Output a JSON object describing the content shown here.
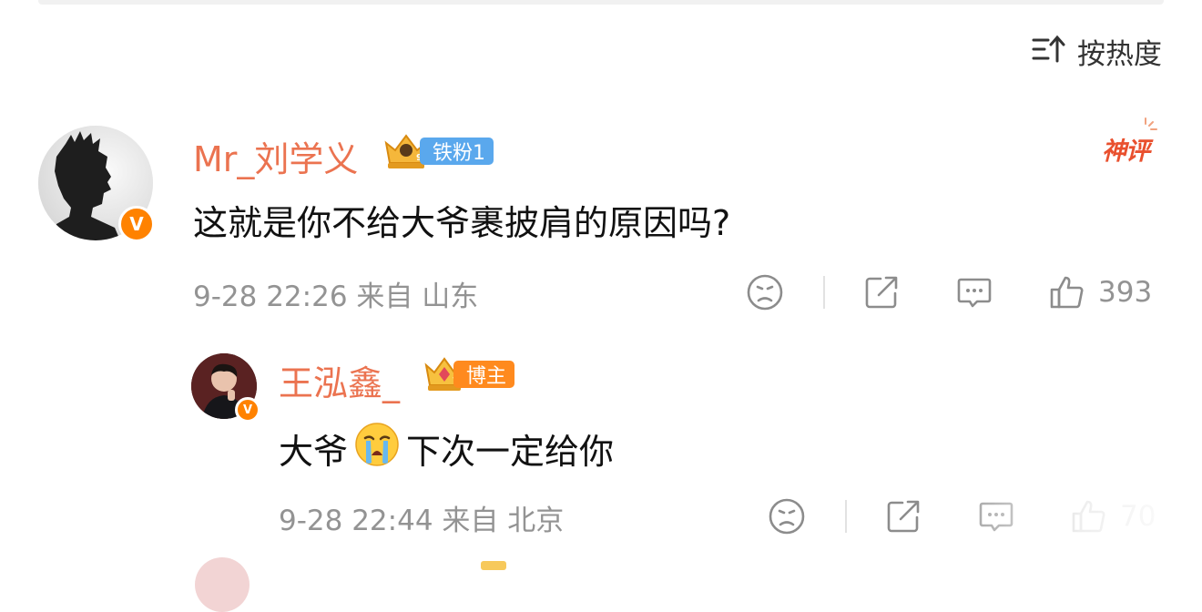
{
  "sort": {
    "label": "按热度",
    "icon": "sort-icon"
  },
  "comment": {
    "username": "Mr_刘学义",
    "crown_level": "9",
    "fan_badge": "铁粉1",
    "tag": "神评",
    "text": "这就是你不给大爷裹披肩的原因吗?",
    "meta": "9-28 22:26 来自 山东",
    "likes": "393"
  },
  "reply": {
    "username": "王泓鑫_",
    "crown_level": "7",
    "role_badge": "博主",
    "text_before": "大爷",
    "emoji": "crying-face",
    "text_after": "下次一定给你",
    "meta": "9-28 22:44 来自 北京",
    "likes": "70"
  },
  "colors": {
    "username": "#eb7350",
    "meta": "#939393",
    "fan_badge": "#5aa8ed",
    "blogger_badge": "#ff8a1e",
    "verified": "#ff8200",
    "tag": "#e9502e"
  }
}
